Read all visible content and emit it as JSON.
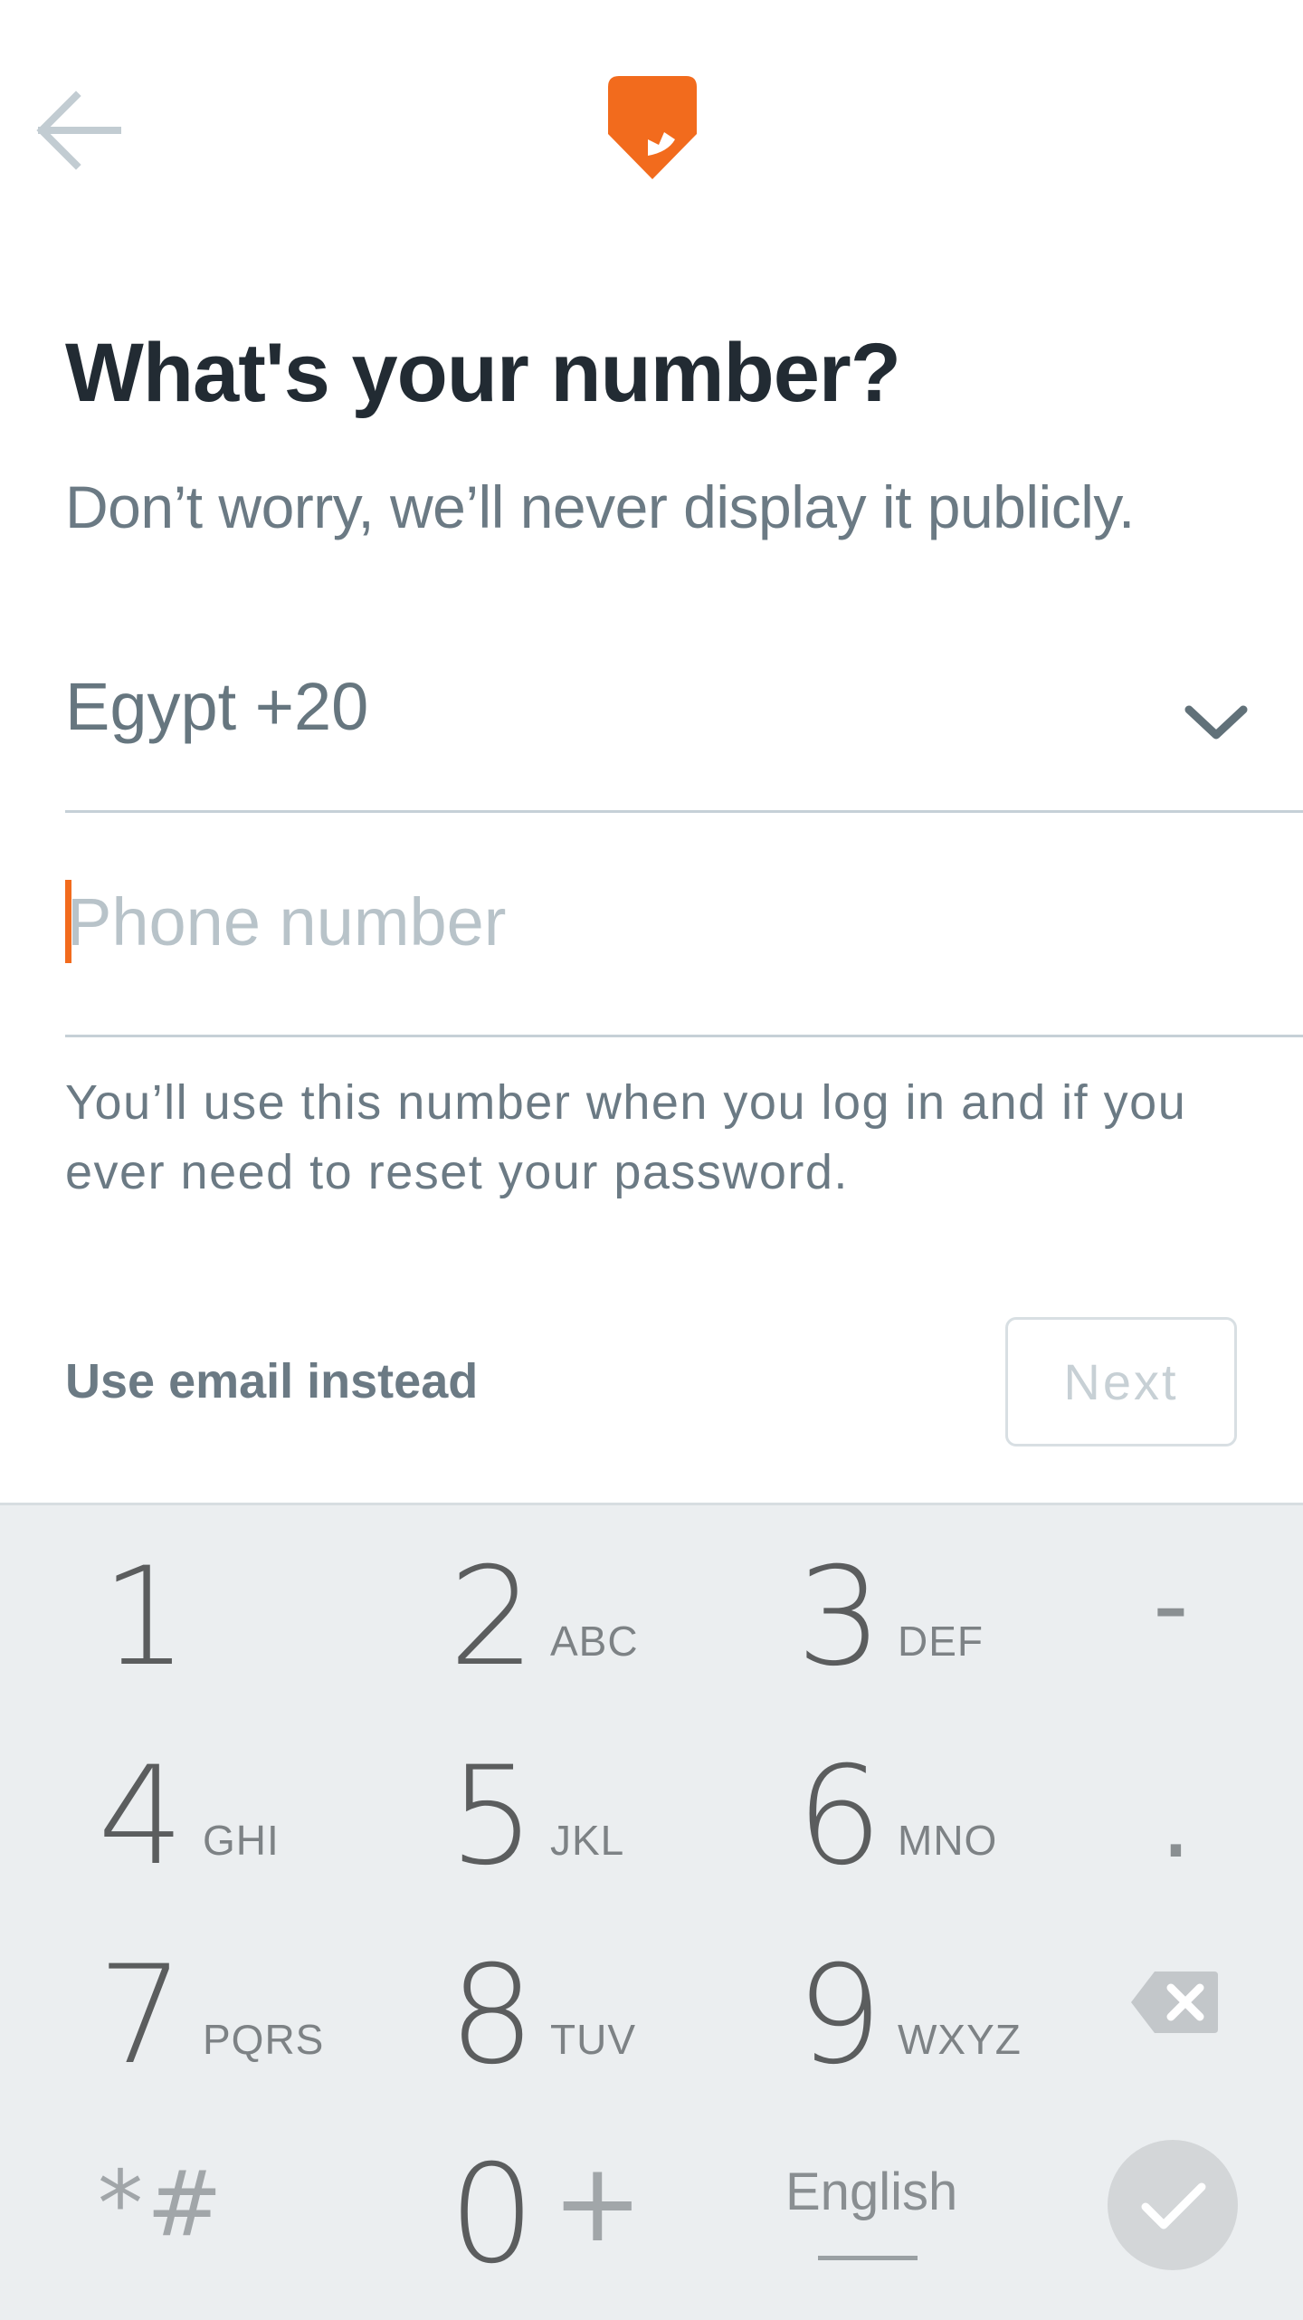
{
  "header": {
    "back_icon": "arrow-left-icon",
    "logo_icon": "orange-shield-logo-icon",
    "accent_color": "#f26b1d"
  },
  "form": {
    "title": "What's your number?",
    "subtitle": "Don’t worry, we’ll never display it publicly.",
    "country": "Egypt +20",
    "phone_placeholder": "Phone number",
    "phone_value": "",
    "helper": "You’ll use this number when you log in and if you ever need to reset your password.",
    "email_link": "Use email instead",
    "next_label": "Next"
  },
  "keyboard": {
    "keys": [
      {
        "digit": "1",
        "letters": ""
      },
      {
        "digit": "2",
        "letters": "ABC"
      },
      {
        "digit": "3",
        "letters": "DEF"
      },
      {
        "digit": "4",
        "letters": "GHI"
      },
      {
        "digit": "5",
        "letters": "JKL"
      },
      {
        "digit": "6",
        "letters": "MNO"
      },
      {
        "digit": "7",
        "letters": "PQRS"
      },
      {
        "digit": "8",
        "letters": "TUV"
      },
      {
        "digit": "9",
        "letters": "WXYZ"
      },
      {
        "digit": "0",
        "letters": ""
      }
    ],
    "dash": "-",
    "dot": ".",
    "star_hash": "*#",
    "plus": "+",
    "language": "English",
    "backspace_icon": "backspace-icon",
    "done_icon": "checkmark-icon"
  }
}
